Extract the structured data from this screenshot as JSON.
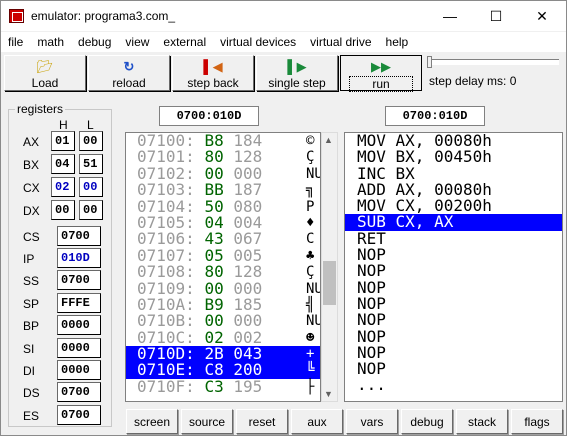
{
  "window": {
    "title": "emulator: programa3.com_",
    "min_glyph": "—",
    "max_glyph": "☐",
    "close_glyph": "✕"
  },
  "menu": [
    "file",
    "math",
    "debug",
    "view",
    "external",
    "virtual devices",
    "virtual drive",
    "help"
  ],
  "toolbar": {
    "load": "Load",
    "reload": "reload",
    "step_back": "step back",
    "single_step": "single step",
    "run": "run",
    "delay_label": "step delay ms: 0"
  },
  "registers": {
    "title": "registers",
    "h": "H",
    "l": "L",
    "AX": {
      "label": "AX",
      "h": "01",
      "l": "00"
    },
    "BX": {
      "label": "BX",
      "h": "04",
      "l": "51"
    },
    "CX": {
      "label": "CX",
      "h": "02",
      "l": "00"
    },
    "DX": {
      "label": "DX",
      "h": "00",
      "l": "00"
    },
    "CS": {
      "label": "CS",
      "v": "0700"
    },
    "IP": {
      "label": "IP",
      "v": "010D"
    },
    "SS": {
      "label": "SS",
      "v": "0700"
    },
    "SP": {
      "label": "SP",
      "v": "FFFE"
    },
    "BP": {
      "label": "BP",
      "v": "0000"
    },
    "SI": {
      "label": "SI",
      "v": "0000"
    },
    "DI": {
      "label": "DI",
      "v": "0000"
    },
    "DS": {
      "label": "DS",
      "v": "0700"
    },
    "ES": {
      "label": "ES",
      "v": "0700"
    }
  },
  "memory_address": "0700:010D",
  "disasm_address": "0700:010D",
  "memory": [
    {
      "addr": "07100:",
      "hex": "B8",
      "dec": "184",
      "chr": "©"
    },
    {
      "addr": "07101:",
      "hex": "80",
      "dec": "128",
      "chr": "Ç"
    },
    {
      "addr": "07102:",
      "hex": "00",
      "dec": "000",
      "chr": "NU"
    },
    {
      "addr": "07103:",
      "hex": "BB",
      "dec": "187",
      "chr": "╗"
    },
    {
      "addr": "07104:",
      "hex": "50",
      "dec": "080",
      "chr": "P"
    },
    {
      "addr": "07105:",
      "hex": "04",
      "dec": "004",
      "chr": "♦"
    },
    {
      "addr": "07106:",
      "hex": "43",
      "dec": "067",
      "chr": "C"
    },
    {
      "addr": "07107:",
      "hex": "05",
      "dec": "005",
      "chr": "♣"
    },
    {
      "addr": "07108:",
      "hex": "80",
      "dec": "128",
      "chr": "Ç"
    },
    {
      "addr": "07109:",
      "hex": "00",
      "dec": "000",
      "chr": "NU"
    },
    {
      "addr": "0710A:",
      "hex": "B9",
      "dec": "185",
      "chr": "╣"
    },
    {
      "addr": "0710B:",
      "hex": "00",
      "dec": "000",
      "chr": "NU"
    },
    {
      "addr": "0710C:",
      "hex": "02",
      "dec": "002",
      "chr": "☻"
    },
    {
      "addr": "0710D:",
      "hex": "2B",
      "dec": "043",
      "chr": "+",
      "sel": true
    },
    {
      "addr": "0710E:",
      "hex": "C8",
      "dec": "200",
      "chr": "╚",
      "sel": true
    },
    {
      "addr": "0710F:",
      "hex": "C3",
      "dec": "195",
      "chr": "├"
    }
  ],
  "disasm": [
    {
      "text": "MOV AX, 00080h"
    },
    {
      "text": "MOV BX, 00450h"
    },
    {
      "text": "INC BX"
    },
    {
      "text": "ADD AX, 00080h"
    },
    {
      "text": "MOV CX, 00200h"
    },
    {
      "text": "SUB CX, AX",
      "sel": true
    },
    {
      "text": "RET"
    },
    {
      "text": "NOP"
    },
    {
      "text": "NOP"
    },
    {
      "text": "NOP"
    },
    {
      "text": "NOP"
    },
    {
      "text": "NOP"
    },
    {
      "text": "NOP"
    },
    {
      "text": "NOP"
    },
    {
      "text": "NOP"
    },
    {
      "text": "..."
    }
  ],
  "bottom": [
    "screen",
    "source",
    "reset",
    "aux",
    "vars",
    "debug",
    "stack",
    "flags"
  ],
  "colors": {
    "selection": "#0000ff",
    "hex_green": "#006400",
    "register_blue": "#0000c0"
  }
}
